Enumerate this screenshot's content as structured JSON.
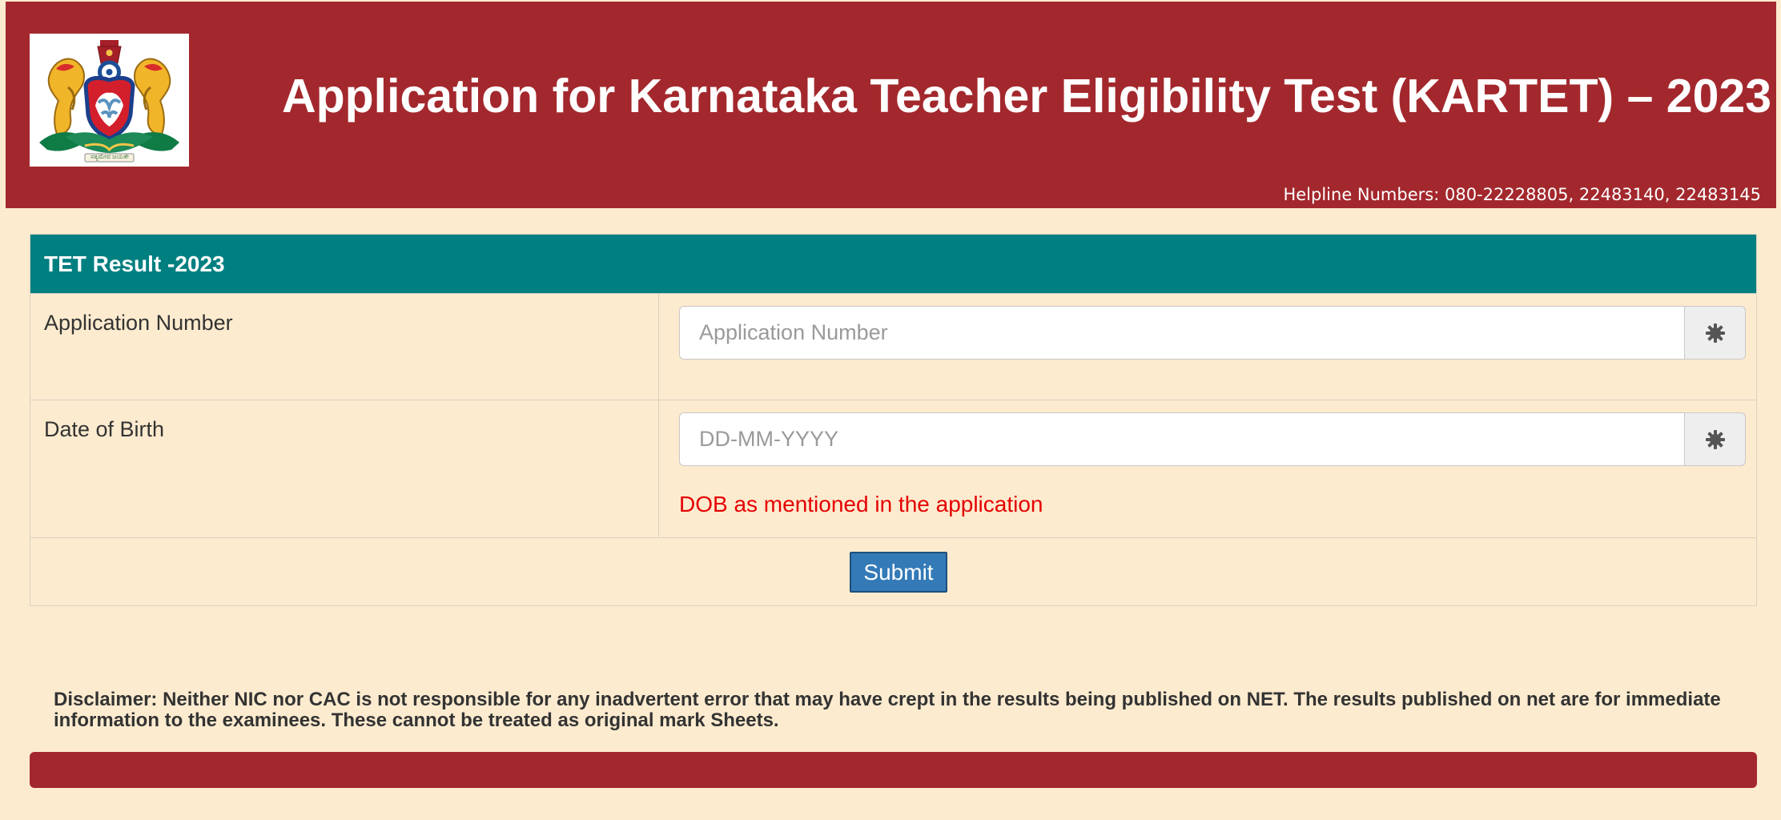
{
  "header": {
    "title": "Application for Karnataka Teacher Eligibility Test (KARTET) – 2023",
    "helpline": "Helpline Numbers: 080-22228805, 22483140, 22483145",
    "emblem_caption": "ಸತ್ಯಮೇವ ಜಯತೇ"
  },
  "form": {
    "heading": "TET Result -2023",
    "application_number": {
      "label": "Application Number",
      "placeholder": "Application Number",
      "value": "",
      "addon_icon": "asterisk-icon"
    },
    "dob": {
      "label": "Date of Birth",
      "placeholder": "DD-MM-YYYY",
      "value": "",
      "hint": "DOB as mentioned in the application",
      "addon_icon": "asterisk-icon"
    },
    "submit_label": "Submit"
  },
  "disclaimer": "Disclaimer: Neither NIC nor CAC is not responsible for any inadvertent error that may have crept in the results being published on NET. The results published on net are for immediate information to the examinees. These cannot be treated as original mark Sheets.",
  "colors": {
    "header_bg": "#a3282d",
    "panel_heading_bg": "#007f80",
    "page_bg": "#fdebcf",
    "hint_text": "#e40000",
    "submit_bg": "#337ab7"
  }
}
